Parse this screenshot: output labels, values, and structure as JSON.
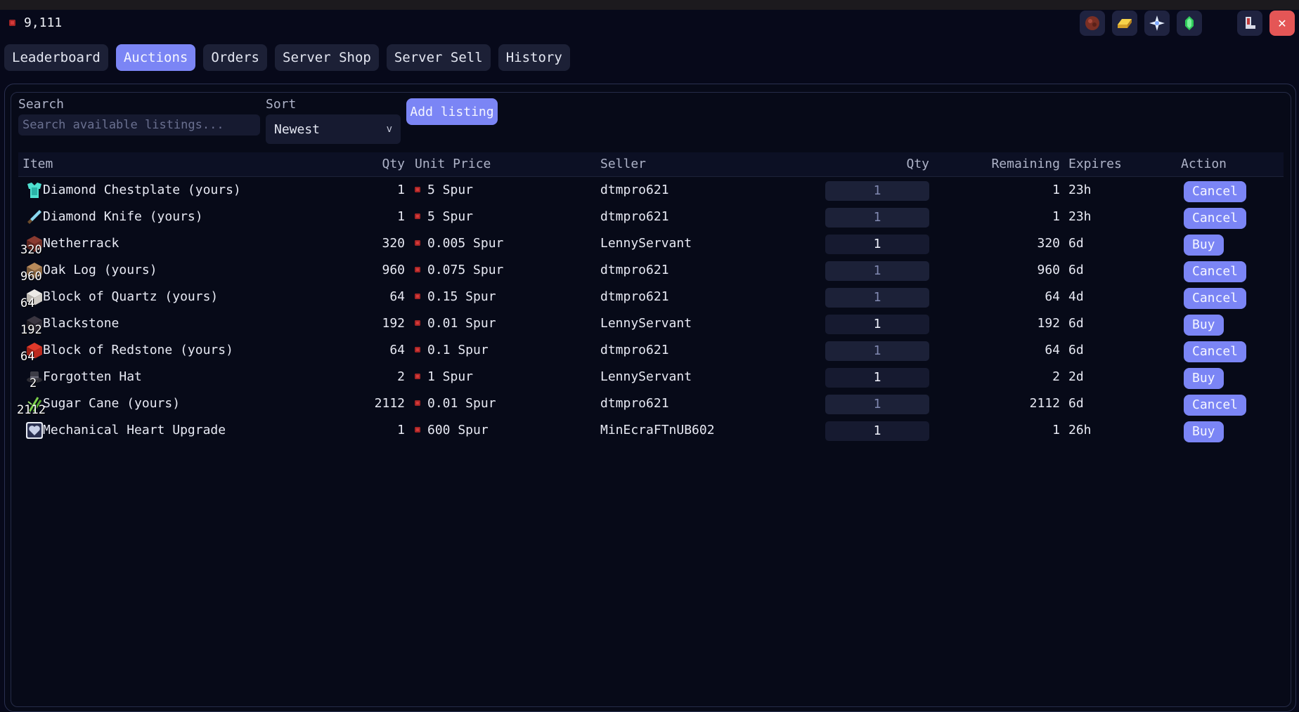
{
  "balance": "9,111",
  "tabs": [
    {
      "label": "Leaderboard",
      "active": false
    },
    {
      "label": "Auctions",
      "active": true
    },
    {
      "label": "Orders",
      "active": false
    },
    {
      "label": "Server Shop",
      "active": false
    },
    {
      "label": "Server Sell",
      "active": false
    },
    {
      "label": "History",
      "active": false
    }
  ],
  "toolbar": {
    "search_label": "Search",
    "search_placeholder": "Search available listings...",
    "sort_label": "Sort",
    "sort_value": "Newest",
    "add_listing_label": "Add listing"
  },
  "table": {
    "columns": [
      "Item",
      "Qty",
      "Unit Price",
      "Seller",
      "Qty",
      "Remaining",
      "Expires",
      "Action"
    ],
    "rows": [
      {
        "name": "Diamond Chestplate (yours)",
        "icon": "diamond-chestplate-icon",
        "stack": "",
        "qty": "1",
        "price": "5 Spur",
        "seller": "dtmpro621",
        "buy_qty": "1",
        "remaining": "1",
        "expires": "23h",
        "action": "Cancel"
      },
      {
        "name": "Diamond Knife (yours)",
        "icon": "diamond-knife-icon",
        "stack": "",
        "qty": "1",
        "price": "5 Spur",
        "seller": "dtmpro621",
        "buy_qty": "1",
        "remaining": "1",
        "expires": "23h",
        "action": "Cancel"
      },
      {
        "name": "Netherrack",
        "icon": "netherrack-icon",
        "stack": "320",
        "qty": "320",
        "price": "0.005 Spur",
        "seller": "LennyServant",
        "buy_qty": "1",
        "remaining": "320",
        "expires": "6d",
        "action": "Buy"
      },
      {
        "name": "Oak Log (yours)",
        "icon": "oak-log-icon",
        "stack": "960",
        "qty": "960",
        "price": "0.075 Spur",
        "seller": "dtmpro621",
        "buy_qty": "1",
        "remaining": "960",
        "expires": "6d",
        "action": "Cancel"
      },
      {
        "name": "Block of Quartz (yours)",
        "icon": "quartz-block-icon",
        "stack": "64",
        "qty": "64",
        "price": "0.15 Spur",
        "seller": "dtmpro621",
        "buy_qty": "1",
        "remaining": "64",
        "expires": "4d",
        "action": "Cancel"
      },
      {
        "name": "Blackstone",
        "icon": "blackstone-icon",
        "stack": "192",
        "qty": "192",
        "price": "0.01 Spur",
        "seller": "LennyServant",
        "buy_qty": "1",
        "remaining": "192",
        "expires": "6d",
        "action": "Buy"
      },
      {
        "name": "Block of Redstone (yours)",
        "icon": "redstone-block-icon",
        "stack": "64",
        "qty": "64",
        "price": "0.1 Spur",
        "seller": "dtmpro621",
        "buy_qty": "1",
        "remaining": "64",
        "expires": "6d",
        "action": "Cancel"
      },
      {
        "name": "Forgotten Hat",
        "icon": "forgotten-hat-icon",
        "stack": "2",
        "qty": "2",
        "price": "1 Spur",
        "seller": "LennyServant",
        "buy_qty": "1",
        "remaining": "2",
        "expires": "2d",
        "action": "Buy"
      },
      {
        "name": "Sugar Cane (yours)",
        "icon": "sugar-cane-icon",
        "stack": "2112",
        "qty": "2112",
        "price": "0.01 Spur",
        "seller": "dtmpro621",
        "buy_qty": "1",
        "remaining": "2112",
        "expires": "6d",
        "action": "Cancel"
      },
      {
        "name": "Mechanical Heart Upgrade",
        "icon": "mechanical-heart-icon",
        "stack": "",
        "qty": "1",
        "price": "600 Spur",
        "seller": "MinEcraFTnUB602",
        "buy_qty": "1",
        "remaining": "1",
        "expires": "26h",
        "action": "Buy"
      }
    ]
  },
  "colors": {
    "accent": "#7b85f5",
    "background": "#07091a",
    "coin": "#d33a3a",
    "close": "#e45656"
  }
}
